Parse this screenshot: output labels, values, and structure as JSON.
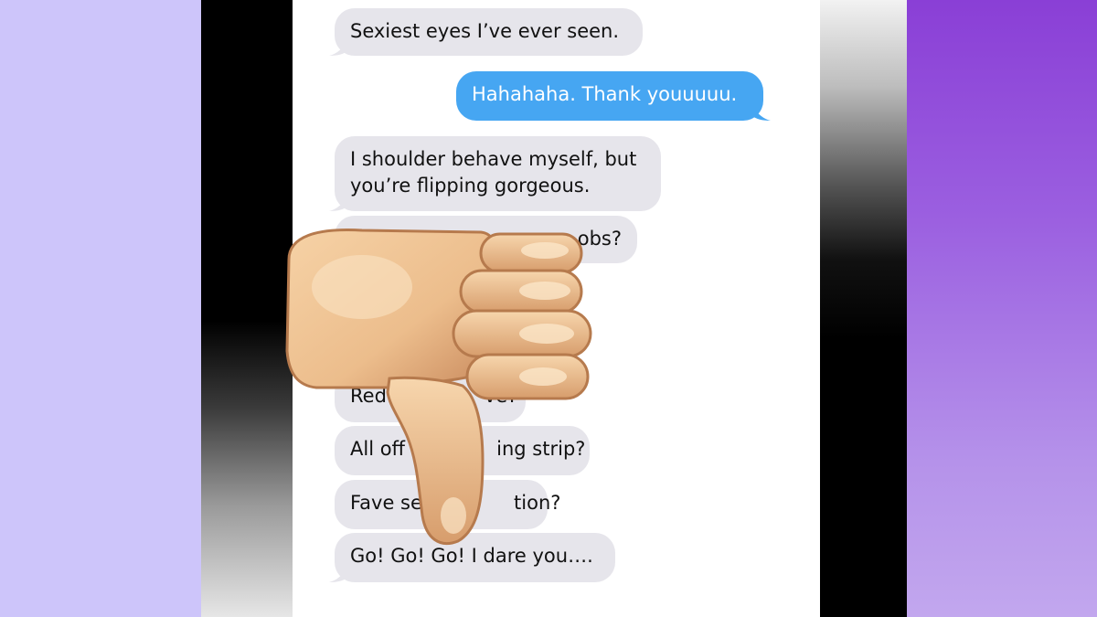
{
  "conversation": {
    "messages": [
      {
        "id": "m1",
        "direction": "received",
        "text": "Sexiest eyes I’ve ever seen."
      },
      {
        "id": "m2",
        "direction": "sent",
        "text": "Hahahaha. Thank youuuuu."
      },
      {
        "id": "m3",
        "direction": "received",
        "text_line1": "I shoulder behave myself, but",
        "text_line2": "you’re flipping gorgeous."
      },
      {
        "id": "m4",
        "direction": "received",
        "text": "obs?"
      },
      {
        "id": "m5",
        "direction": "received",
        "text": "Red                ve?"
      },
      {
        "id": "m6",
        "direction": "received",
        "text": "All off               ing strip?"
      },
      {
        "id": "m7",
        "direction": "received",
        "text": "Fave se               tion?"
      },
      {
        "id": "m8",
        "direction": "received",
        "text": "Go! Go! Go! I dare you…."
      }
    ]
  },
  "overlay": {
    "icon": "thumbs-down-emoji-icon"
  },
  "colors": {
    "received_bubble": "#e6e5eb",
    "sent_bubble": "#46a6f2",
    "left_panel": "#cdc5fa",
    "right_panel": "#9b5fe0"
  }
}
